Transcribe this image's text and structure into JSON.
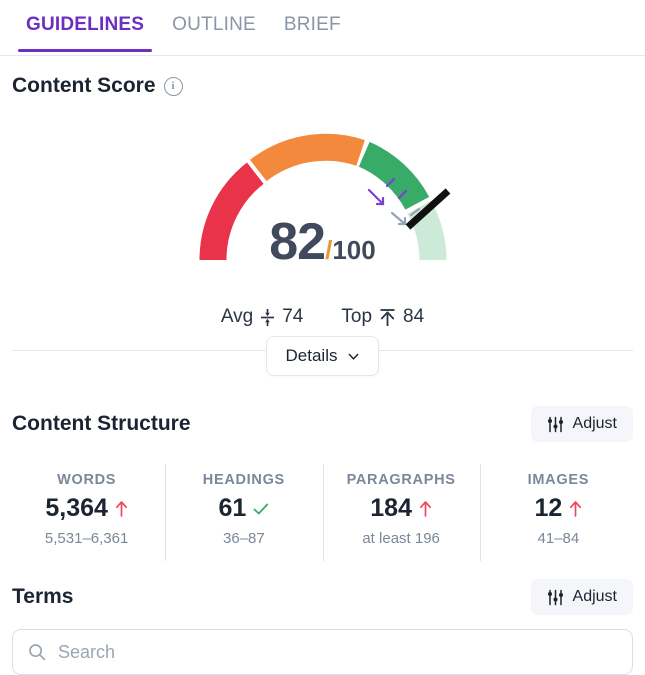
{
  "tabs": [
    {
      "label": "GUIDELINES",
      "active": true
    },
    {
      "label": "OUTLINE",
      "active": false
    },
    {
      "label": "BRIEF",
      "active": false
    }
  ],
  "content_score": {
    "title": "Content Score",
    "info_icon": "info-icon",
    "score": "82",
    "slash": "/",
    "max": "100",
    "details_label": "Details",
    "benchmarks": [
      {
        "label": "Avg",
        "icon": "avg-arrows-icon",
        "value": "74"
      },
      {
        "label": "Top",
        "icon": "top-arrow-icon",
        "value": "84"
      }
    ],
    "gauge": {
      "segments": [
        {
          "name": "poor",
          "color": "#e8334a",
          "from": 0,
          "to": 30
        },
        {
          "name": "fair",
          "color": "#f2893c",
          "from": 31,
          "to": 62
        },
        {
          "name": "good",
          "color": "#39ab68",
          "from": 63,
          "to": 82
        },
        {
          "name": "excellent",
          "color": "#cde9d8",
          "from": 83,
          "to": 100
        }
      ],
      "needle_value": 82,
      "needle_color": "#101010",
      "avg_marker_color": "#7b3fd4",
      "top_marker_color": "#95a3b8"
    }
  },
  "content_structure": {
    "title": "Content Structure",
    "adjust_label": "Adjust",
    "adjust_icon": "sliders-icon",
    "stats": [
      {
        "label": "WORDS",
        "value": "5,364",
        "status": "up",
        "range": "5,531–6,361"
      },
      {
        "label": "HEADINGS",
        "value": "61",
        "status": "check",
        "range": "36–87"
      },
      {
        "label": "PARAGRAPHS",
        "value": "184",
        "status": "up",
        "range": "at least 196"
      },
      {
        "label": "IMAGES",
        "value": "12",
        "status": "up",
        "range": "41–84"
      }
    ]
  },
  "terms": {
    "title": "Terms",
    "adjust_label": "Adjust",
    "adjust_icon": "sliders-icon",
    "search_placeholder": "Search",
    "search_value": "",
    "search_icon": "search-icon"
  },
  "colors": {
    "accent_purple": "#6d2fc0",
    "status_up": "#f0475e",
    "status_ok": "#39ab68",
    "text_dark": "#1c2431",
    "text_muted": "#7b8899"
  }
}
